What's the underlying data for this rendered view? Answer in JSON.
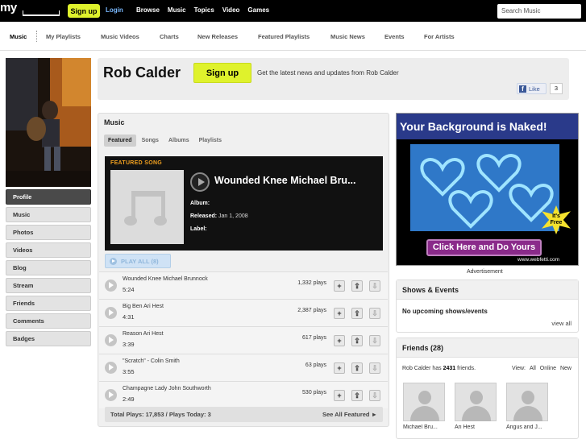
{
  "topbar": {
    "logo": "my",
    "signup": "Sign up",
    "login": "Login",
    "nav": [
      "Browse",
      "Music",
      "Topics",
      "Video",
      "Games"
    ],
    "search_placeholder": "Search Music"
  },
  "subnav": {
    "items": [
      "Music",
      "My Playlists",
      "Music Videos",
      "Charts",
      "New Releases",
      "Featured Playlists",
      "Music News",
      "Events",
      "For Artists"
    ],
    "active": "Music"
  },
  "sidebar": {
    "items": [
      "Profile",
      "Music",
      "Photos",
      "Videos",
      "Blog",
      "Stream",
      "Friends",
      "Comments",
      "Badges"
    ],
    "active": "Profile"
  },
  "header": {
    "artist": "Rob Calder",
    "signup": "Sign up",
    "tagline": "Get the latest news and updates from Rob Calder",
    "like_label": "Like",
    "like_count": "3"
  },
  "music": {
    "title": "Music",
    "tabs": [
      "Featured",
      "Songs",
      "Albums",
      "Playlists"
    ],
    "active_tab": "Featured",
    "featured": {
      "label": "FEATURED SONG",
      "title": "Wounded Knee Michael Bru...",
      "album_label": "Album:",
      "album_value": "",
      "released_label": "Released:",
      "released_value": "Jan 1, 2008",
      "label_label": "Label:",
      "label_value": ""
    },
    "play_all": "PLAY ALL (8)",
    "tracks": [
      {
        "title": "Wounded Knee Michael Brunnock",
        "duration": "5:24",
        "plays": "1,332 plays"
      },
      {
        "title": "Big Ben Ari Hest",
        "duration": "4:31",
        "plays": "2,387 plays"
      },
      {
        "title": "Reason Ari Hest",
        "duration": "3:39",
        "plays": "617 plays"
      },
      {
        "title": "\"Scratch\" - Colin Smith",
        "duration": "3:55",
        "plays": "63 plays"
      },
      {
        "title": "Champagne Lady John Southworth",
        "duration": "2:49",
        "plays": "530 plays"
      }
    ],
    "totals": "Total Plays: 17,853 / Plays Today: 3",
    "see_all": "See All Featured ►"
  },
  "ad": {
    "headline": "Your Background is Naked!",
    "cta": "Click Here and Do Yours",
    "badge": "It's Free",
    "url": "www.webfetti.com",
    "caption": "Advertisement"
  },
  "shows": {
    "title": "Shows & Events",
    "message": "No upcoming shows/events",
    "view_all": "view all"
  },
  "friends": {
    "title": "Friends (28)",
    "count_prefix": "Rob Calder has",
    "count": "2431",
    "count_suffix": "friends.",
    "view_label": "View:",
    "view_options": [
      "All",
      "Online",
      "New"
    ],
    "list": [
      "Michael Bru...",
      "Ari Hest",
      "Angus and J..."
    ]
  }
}
